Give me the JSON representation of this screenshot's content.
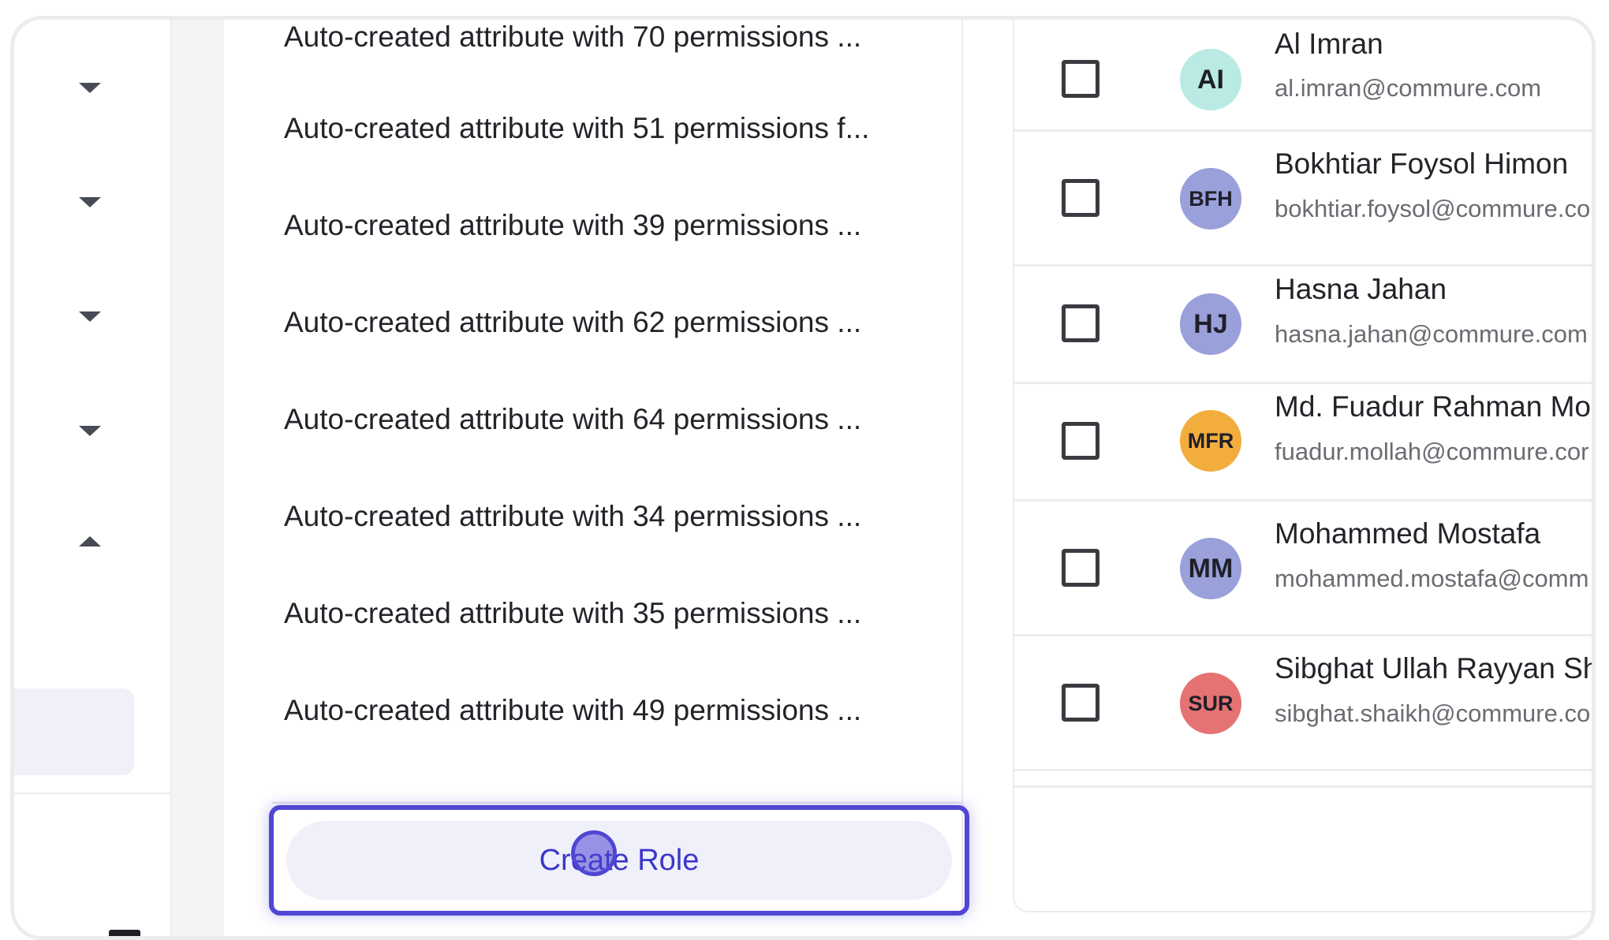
{
  "nav": {
    "chevrons": [
      "chevron-down-icon",
      "chevron-down-icon",
      "chevron-down-icon",
      "chevron-down-icon",
      "chevron-up-icon"
    ]
  },
  "roles": {
    "items": [
      "Auto-created attribute with 70 permissions ...",
      "Auto-created attribute with 51 permissions f...",
      "Auto-created attribute with 39 permissions ...",
      "Auto-created attribute with 62 permissions ...",
      "Auto-created attribute with 64 permissions ...",
      "Auto-created attribute with 34 permissions ...",
      "Auto-created attribute with 35 permissions ...",
      "Auto-created attribute with 49 permissions ..."
    ],
    "create_label": "Create Role"
  },
  "users": [
    {
      "initials": "AI",
      "name": "Al Imran",
      "email": "al.imran@commure.com",
      "color": "#b9eae4"
    },
    {
      "initials": "BFH",
      "name": "Bokhtiar Foysol Himon",
      "email": "bokhtiar.foysol@commure.co",
      "color": "#9aa0da"
    },
    {
      "initials": "HJ",
      "name": "Hasna Jahan",
      "email": "hasna.jahan@commure.com",
      "color": "#9aa0da"
    },
    {
      "initials": "MFR",
      "name": "Md. Fuadur Rahman Mol",
      "email": "fuadur.mollah@commure.cor",
      "color": "#f2ad3d"
    },
    {
      "initials": "MM",
      "name": "Mohammed Mostafa",
      "email": "mohammed.mostafa@comm",
      "color": "#9aa0da"
    },
    {
      "initials": "SUR",
      "name": "Sibghat Ullah Rayyan Sha",
      "email": "sibghat.shaikh@commure.co",
      "color": "#e57373"
    }
  ]
}
